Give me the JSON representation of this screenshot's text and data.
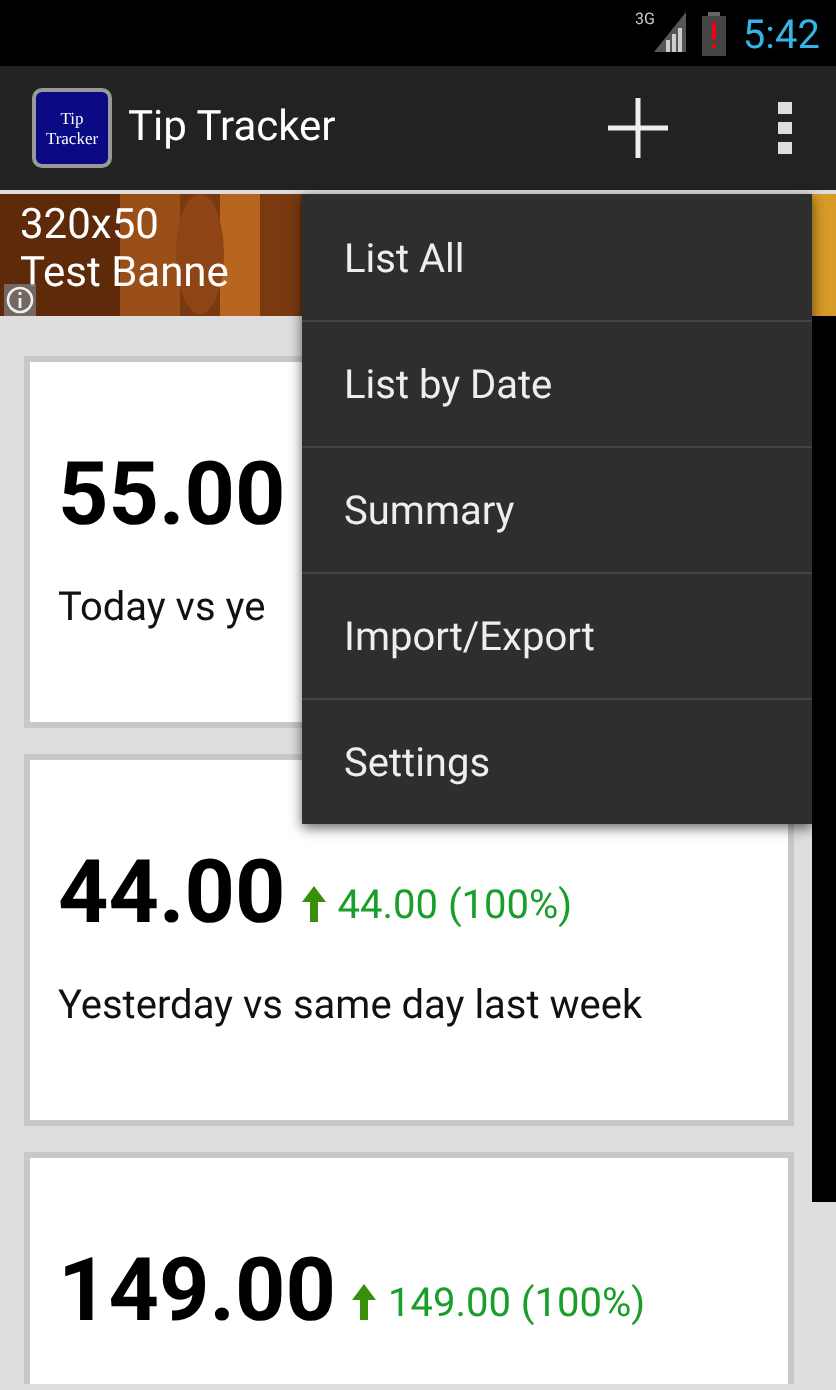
{
  "status_bar": {
    "network": "3G",
    "time": "5:42"
  },
  "action_bar": {
    "logo_lines": [
      "Tip",
      "Tracker"
    ],
    "title": "Tip Tracker"
  },
  "banner": {
    "lines": [
      "320x50",
      "Test Banne"
    ]
  },
  "cards": [
    {
      "value": "55.00",
      "caption": "Today vs ye"
    },
    {
      "value": "44.00",
      "trend": {
        "increase": true,
        "text": "44.00 (100%)"
      },
      "caption": "Yesterday vs same day last week"
    },
    {
      "value": "149.00",
      "trend": {
        "increase": true,
        "text": "149.00 (100%)"
      }
    }
  ],
  "menu": {
    "items": [
      "List All",
      "List by Date",
      "Summary",
      "Import/Export",
      "Settings"
    ]
  }
}
